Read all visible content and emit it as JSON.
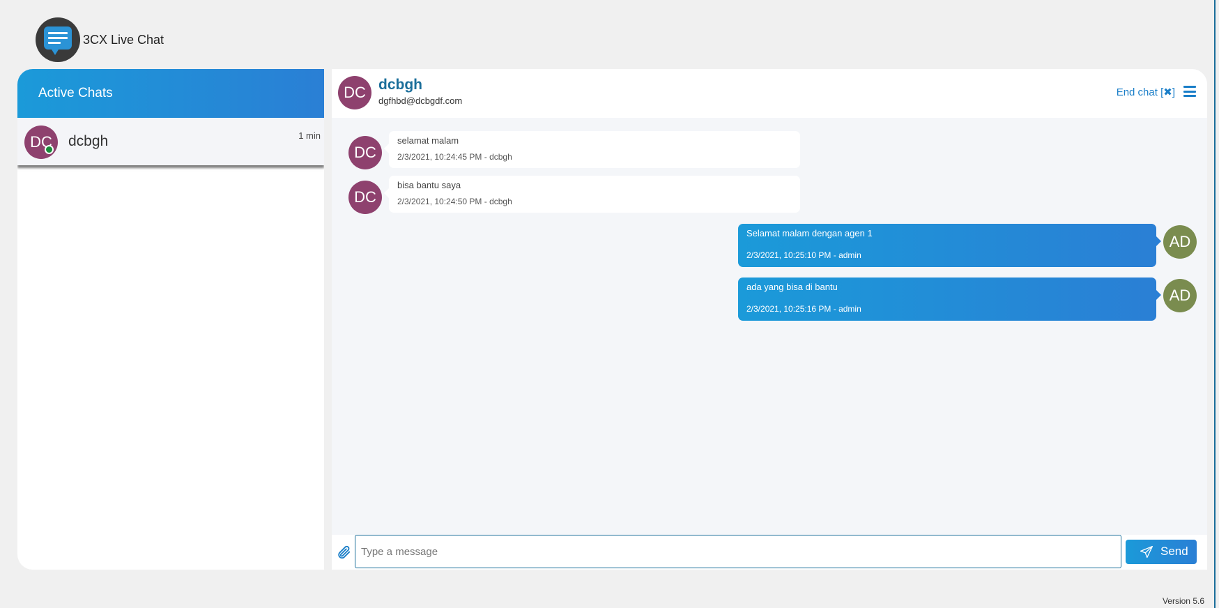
{
  "app": {
    "title": "3CX Live Chat",
    "logo_icon": "chat-bubble-icon",
    "version": "Version 5.6"
  },
  "colors": {
    "accent": "#1b9ad9",
    "accent_dark": "#2a7fd5",
    "dc_avatar": "#8e416e",
    "ad_avatar": "#7a8c4f",
    "online": "#1a8a3a"
  },
  "sidebar": {
    "header": "Active Chats",
    "chats": [
      {
        "initials": "DC",
        "name": "dcbgh",
        "time": "1 min",
        "status": "online"
      }
    ]
  },
  "conversation": {
    "contact": {
      "initials": "DC",
      "name": "dcbgh",
      "email": "dgfhbd@dcbgdf.com"
    },
    "end_chat_label": "End chat [",
    "end_chat_x": "✖",
    "end_chat_close": "]",
    "menu_icon": "hamburger-icon",
    "messages": [
      {
        "direction": "in",
        "initials": "DC",
        "text": "selamat malam",
        "meta": "2/3/2021, 10:24:45 PM - dcbgh"
      },
      {
        "direction": "in",
        "initials": "DC",
        "text": "bisa bantu saya",
        "meta": "2/3/2021, 10:24:50 PM - dcbgh"
      },
      {
        "direction": "out",
        "initials": "AD",
        "text": "Selamat malam dengan agen 1",
        "meta": "2/3/2021, 10:25:10 PM - admin"
      },
      {
        "direction": "out",
        "initials": "AD",
        "text": "ada yang bisa di bantu",
        "meta": "2/3/2021, 10:25:16 PM - admin"
      }
    ]
  },
  "composer": {
    "placeholder": "Type a message",
    "value": "",
    "send_label": "Send",
    "attach_icon": "paperclip-icon",
    "send_icon": "paper-plane-icon"
  }
}
